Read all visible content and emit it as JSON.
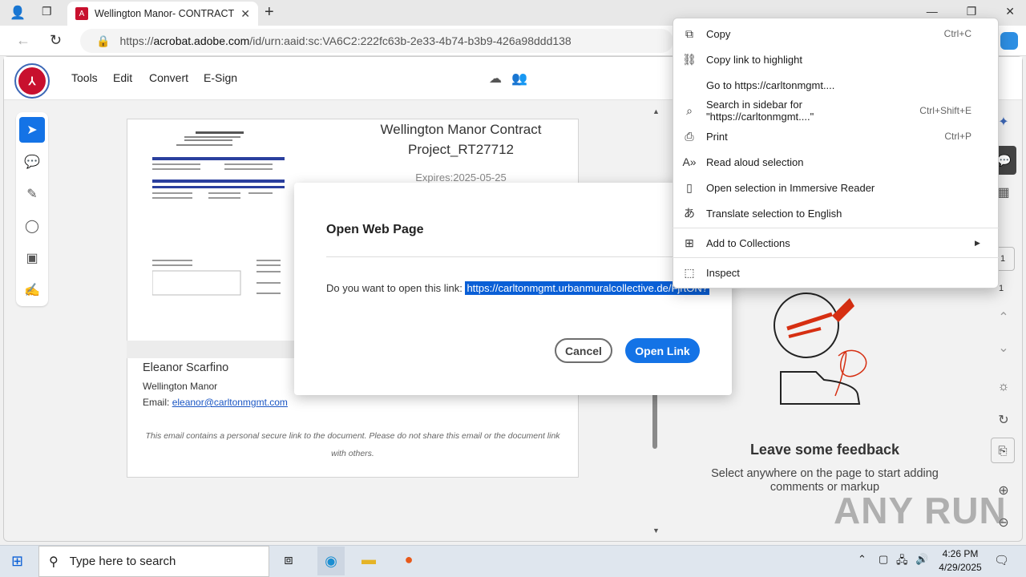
{
  "browser": {
    "tab_title": "Wellington Manor- CONTRACT P",
    "url_prefix": "https://",
    "url_host": "acrobat.adobe.com",
    "url_path": "/id/urn:aaid:sc:VA6C2:222fc63b-2e33-4b74-b3b9-426a98ddd138"
  },
  "acrobat": {
    "menu": [
      "Tools",
      "Edit",
      "Convert",
      "E-Sign"
    ]
  },
  "document": {
    "title_line1": "Wellington Manor Contract",
    "title_line2": "Project_RT27712",
    "expires": "Expires:2025-05-25",
    "sender_name": "Eleanor Scarfino",
    "sender_org": "Wellington Manor",
    "email_label": "Email: ",
    "email": "eleanor@carltonmgmt.com",
    "disclaimer": "This email contains a personal secure link to the document. Please do not share this email or the document link with others."
  },
  "feedback": {
    "title": "Leave some feedback",
    "text": "Select anywhere on the page to start adding comments or markup"
  },
  "dialog": {
    "title": "Open Web Page",
    "message": "Do you want to open this link: ",
    "link": "https://carltonmgmt.urbanmuralcollective.de/FjrtON?",
    "cancel": "Cancel",
    "open": "Open Link"
  },
  "context_menu": {
    "items": [
      {
        "label": "Copy",
        "shortcut": "Ctrl+C",
        "icon": "copy-icon"
      },
      {
        "label": "Copy link to highlight",
        "shortcut": "",
        "icon": "link-highlight-icon"
      },
      {
        "label": "Go to https://carltonmgmt....",
        "shortcut": "",
        "icon": ""
      },
      {
        "label": "Search in sidebar for \"https://carltonmgmt....\"",
        "shortcut": "Ctrl+Shift+E",
        "icon": "sidebar-search-icon"
      },
      {
        "label": "Print",
        "shortcut": "Ctrl+P",
        "icon": "print-icon"
      },
      {
        "label": "Read aloud selection",
        "shortcut": "",
        "icon": "read-aloud-icon"
      },
      {
        "label": "Open selection in Immersive Reader",
        "shortcut": "",
        "icon": "immersive-reader-icon"
      },
      {
        "label": "Translate selection to English",
        "shortcut": "",
        "icon": "translate-icon"
      },
      {
        "label": "Add to Collections",
        "shortcut": "",
        "icon": "collections-icon"
      },
      {
        "label": "Inspect",
        "shortcut": "",
        "icon": "inspect-icon"
      }
    ]
  },
  "taskbar": {
    "search_placeholder": "Type here to search",
    "time": "4:26 PM",
    "date": "4/29/2025"
  },
  "watermark": "ANY RUN"
}
